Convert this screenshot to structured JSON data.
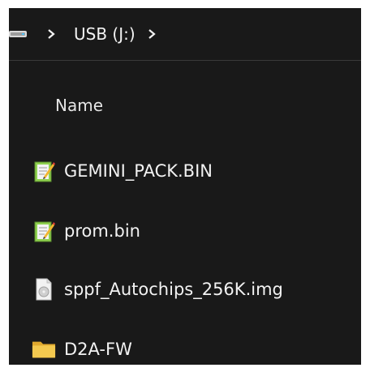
{
  "breadcrumb": {
    "drive_icon": "usb-drive-icon",
    "separator_icon": "chevron-right-icon",
    "items": [
      {
        "label": "USB (J:)"
      }
    ]
  },
  "list": {
    "column_header": "Name",
    "files": [
      {
        "name": "GEMINI_PACK.BIN",
        "icon": "notepad-file-icon"
      },
      {
        "name": "prom.bin",
        "icon": "notepad-file-icon"
      },
      {
        "name": "sppf_Autochips_256K.img",
        "icon": "disc-image-file-icon"
      },
      {
        "name": "D2A-FW",
        "icon": "folder-icon"
      }
    ]
  },
  "colors": {
    "background": "#191919",
    "text": "#f2f2f2",
    "folder": "#f3c94f"
  }
}
